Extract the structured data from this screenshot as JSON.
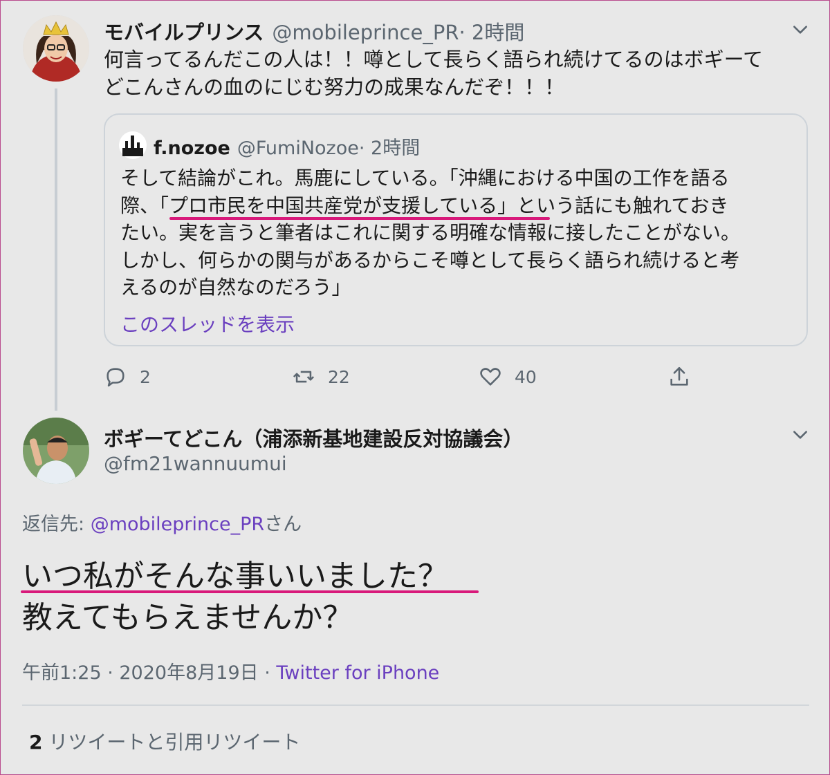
{
  "tweet1": {
    "display_name": "モバイルプリンス",
    "handle": "@mobileprince_PR",
    "time": " · 2時間",
    "text_line1": "何言ってるんだこの人は！！噂として長らく語られ続けてるのはボギーて",
    "text_line2": "どこんさんの血のにじむ努力の成果なんだぞ！！！"
  },
  "quote": {
    "display_name": "f.nozoe",
    "handle": "@FumiNozoe",
    "time": " · 2時間",
    "lines": [
      "そして結論がこれ。馬鹿にしている。「沖縄における中国の工作を語る",
      "際、「プロ市民を中国共産党が支援している」という話にも触れておき",
      "たい。実を言うと筆者はこれに関する明確な情報に接したことがない。",
      "しかし、何らかの関与があるからこそ噂として長らく語られ続けると考",
      "えるのが自然なのだろう」"
    ],
    "show_thread": "このスレッドを表示"
  },
  "actions": {
    "reply_count": "2",
    "retweet_count": "22",
    "like_count": "40"
  },
  "tweet2": {
    "display_name": "ボギーてどこん（浦添新基地建設反対協議会）",
    "handle": "@fm21wannuumui",
    "replying_prefix": "返信先: ",
    "replying_mention": "@mobileprince_PR",
    "replying_suffix": "さん",
    "text_line1": "いつ私がそんな事いいました？",
    "text_line2": "教えてもらえませんか？",
    "timestamp": "午前1:25 · 2020年8月19日 · ",
    "source": "Twitter for iPhone"
  },
  "stats": {
    "retweet_count": "2",
    "retweet_label": " リツイートと引用リツイート"
  },
  "colors": {
    "highlight": "#d8197a",
    "link": "#6a3fbf",
    "frame": "#b84a8c"
  }
}
